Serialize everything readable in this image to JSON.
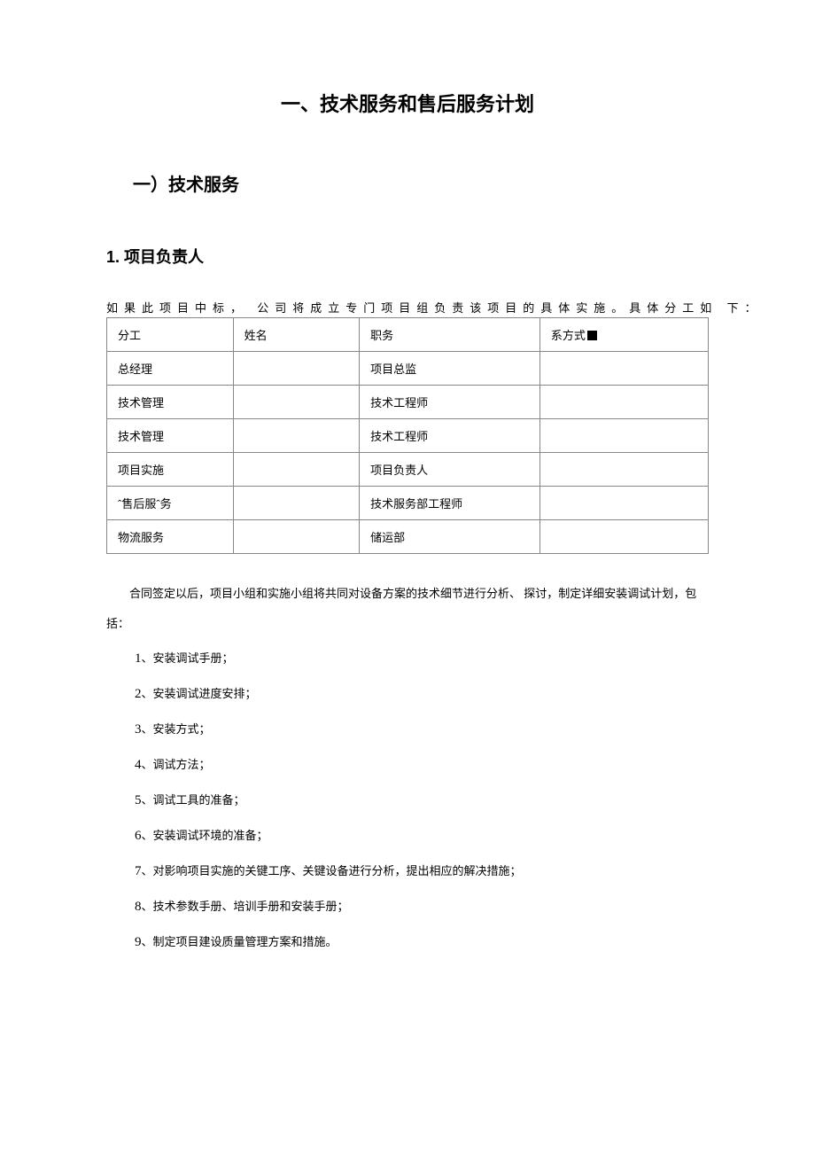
{
  "title": "一、技术服务和售后服务计划",
  "section_heading": "一）技术服务",
  "sub_heading": "1.  项目负责人",
  "intro": "如果此项目中标， 公司将成立专门项目组负责该项目的具体实施。具体分工如 下：",
  "table": {
    "headers": [
      "分工",
      "姓名",
      "职务",
      "系方式"
    ],
    "rows": [
      {
        "role": "总经理",
        "name": "",
        "title": "项目总监",
        "contact": ""
      },
      {
        "role": "技术管理",
        "name": "",
        "title": "技术工程师",
        "contact": ""
      },
      {
        "role": "技术管理",
        "name": "",
        "title": "技术工程师",
        "contact": ""
      },
      {
        "role": "项目实施",
        "name": "",
        "title": "项目负责人",
        "contact": ""
      },
      {
        "role": "ˆ售后服ˆ务",
        "name": "",
        "title": "技术服务部工程师",
        "contact": ""
      },
      {
        "role": "物流服务",
        "name": "",
        "title": "储运部",
        "contact": ""
      }
    ]
  },
  "paragraph": "合同签定以后，项目小组和实施小组将共同对设备方案的技术细节进行分析、 探讨，制定详细安装调试计划，包括：",
  "list": [
    "安装调试手册；",
    "安装调试进度安排；",
    "安装方式；",
    "调试方法；",
    "调试工具的准备；",
    "安装调试环境的准备；",
    "对影响项目实施的关键工序、关键设备进行分析，提出相应的解决措施；",
    "技术参数手册、培训手册和安装手册；",
    "制定项目建设质量管理方案和措施。"
  ]
}
